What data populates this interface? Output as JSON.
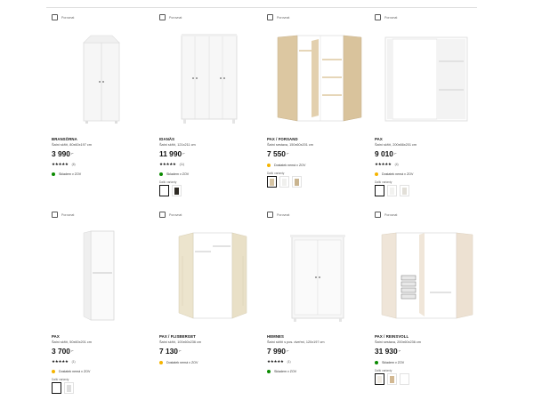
{
  "compare_label": "Porovnat",
  "variants_title": "Další varianty",
  "colors": {
    "in_stock": "#0a8a00",
    "limited": "#f5b400",
    "text": "#111111"
  },
  "products": [
    {
      "name": "BRANSÖRNA",
      "description": "Šatní skříň, 80x60x197 cm",
      "price": "3 990",
      "currency": ",-",
      "rating": 5,
      "review_count": "(6)",
      "stock_status": "in_stock",
      "stock_text": "Skladem v ZOV",
      "image": "wardrobe-two-door-white-icon",
      "variants": []
    },
    {
      "name": "IDANÄS",
      "description": "Šatní skříň, 121x211 cm",
      "price": "11 990",
      "currency": ",-",
      "rating": 4.5,
      "review_count": "(11)",
      "stock_status": "in_stock",
      "stock_text": "Skladem v ZOV",
      "image": "wardrobe-four-door-white-icon",
      "variants": [
        "#ffffff",
        "#2e2a24"
      ]
    },
    {
      "name": "PAX / FORSAND",
      "description": "Šatní sestava, 150x60x201 cm",
      "price": "7 550",
      "currency": ",-",
      "rating": null,
      "review_count": "",
      "stock_status": "limited",
      "stock_text": "Dostatek nemá v ZOV",
      "image": "wardrobe-open-oak-doors-icon",
      "variants": [
        "#d6c4a3",
        "#f0f0ee",
        "#c9b48f"
      ]
    },
    {
      "name": "PAX",
      "description": "Šatní skříň, 200x66x201 cm",
      "price": "9 010",
      "currency": ",-",
      "rating": 4.5,
      "review_count": "(4)",
      "stock_status": "limited",
      "stock_text": "Dostatek nemá v ZOV",
      "image": "wardrobe-sliding-doors-white-icon",
      "variants": [
        "#ffffff",
        "#f2f2f0",
        "#e2dfd8"
      ]
    },
    {
      "name": "PAX",
      "description": "Šatní skříň, 50x60x201 cm",
      "price": "3 700",
      "currency": ",-",
      "rating": 5,
      "review_count": "(1)",
      "stock_status": "limited",
      "stock_text": "Dostatek nemá v ZOV",
      "image": "wardrobe-single-door-white-icon",
      "variants": [
        "#ffffff",
        "#dedede"
      ]
    },
    {
      "name": "PAX / FLISBERGET",
      "description": "Šatní skříň, 100x60x236 cm",
      "price": "7 130",
      "currency": ",-",
      "rating": null,
      "review_count": "",
      "stock_status": "limited",
      "stock_text": "Dostatek nemá v ZOV",
      "image": "wardrobe-beige-doors-icon",
      "variants": []
    },
    {
      "name": "HEMNES",
      "description": "Šatní skříň s pos. dveřmi, 120x197 cm",
      "price": "7 990",
      "currency": ",-",
      "rating": 5,
      "review_count": "(1)",
      "stock_status": "in_stock",
      "stock_text": "Skladem v ZOV",
      "image": "wardrobe-hemnes-white-icon",
      "variants": []
    },
    {
      "name": "PAX / REINSVOLL",
      "description": "Šatní sestava, 200x60x236 cm",
      "price": "31 930",
      "currency": ",-",
      "rating": null,
      "review_count": "",
      "stock_status": "in_stock",
      "stock_text": "Skladem v ZOV",
      "image": "wardrobe-open-drawers-beige-icon",
      "variants": [
        "#f0ebe3",
        "#d2b892",
        "#ffffff"
      ]
    }
  ]
}
